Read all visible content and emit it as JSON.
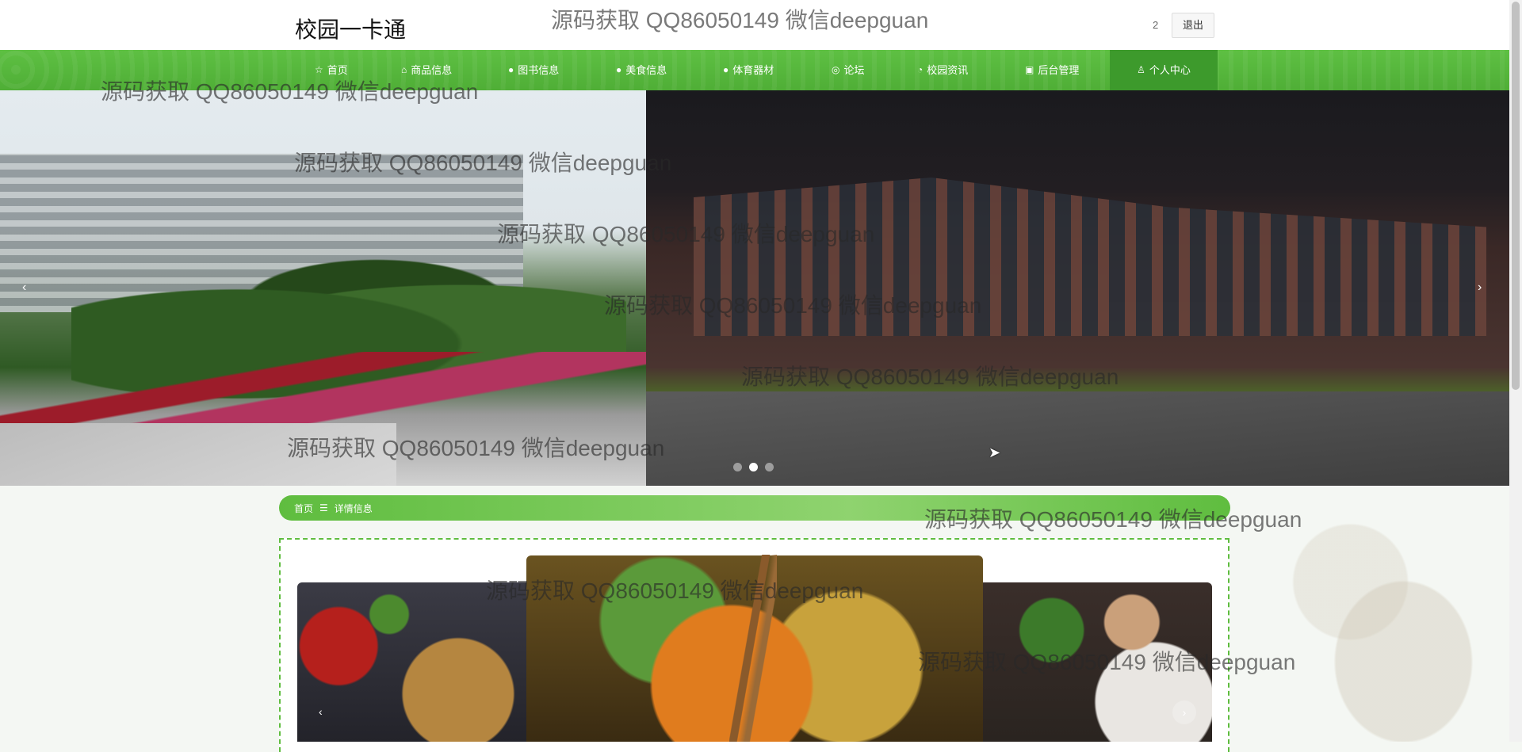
{
  "header": {
    "site_title": "校园一卡通",
    "user_num": "2",
    "logout_label": "退出"
  },
  "nav": {
    "items": [
      {
        "icon": "star-icon",
        "glyph": "☆",
        "label": "首页"
      },
      {
        "icon": "bag-icon",
        "glyph": "⌂",
        "label": "商品信息"
      },
      {
        "icon": "question-icon",
        "glyph": "●",
        "label": "图书信息"
      },
      {
        "icon": "question-icon",
        "glyph": "●",
        "label": "美食信息"
      },
      {
        "icon": "info-icon",
        "glyph": "●",
        "label": "体育器材"
      },
      {
        "icon": "gear-icon",
        "glyph": "◎",
        "label": "论坛"
      },
      {
        "icon": "clock-icon",
        "glyph": "◔",
        "label": "校园资讯"
      },
      {
        "icon": "building-icon",
        "glyph": "▣",
        "label": "后台管理"
      },
      {
        "icon": "user-icon",
        "glyph": "♙",
        "label": "个人中心"
      }
    ],
    "active_index": 8
  },
  "banner": {
    "prev_glyph": "‹",
    "next_glyph": "›",
    "dots": 3,
    "active_dot": 1
  },
  "breadcrumb": {
    "home": "首页",
    "separator": "☰",
    "current": "详情信息"
  },
  "carousel": {
    "prev_glyph": "‹",
    "next_glyph": "›"
  },
  "watermark": {
    "text": "源码获取 QQ86050149 微信deepguan"
  },
  "colors": {
    "nav_green": "#5ec043",
    "nav_active": "#3d9a2c",
    "accent_green": "#5fbd3f"
  }
}
